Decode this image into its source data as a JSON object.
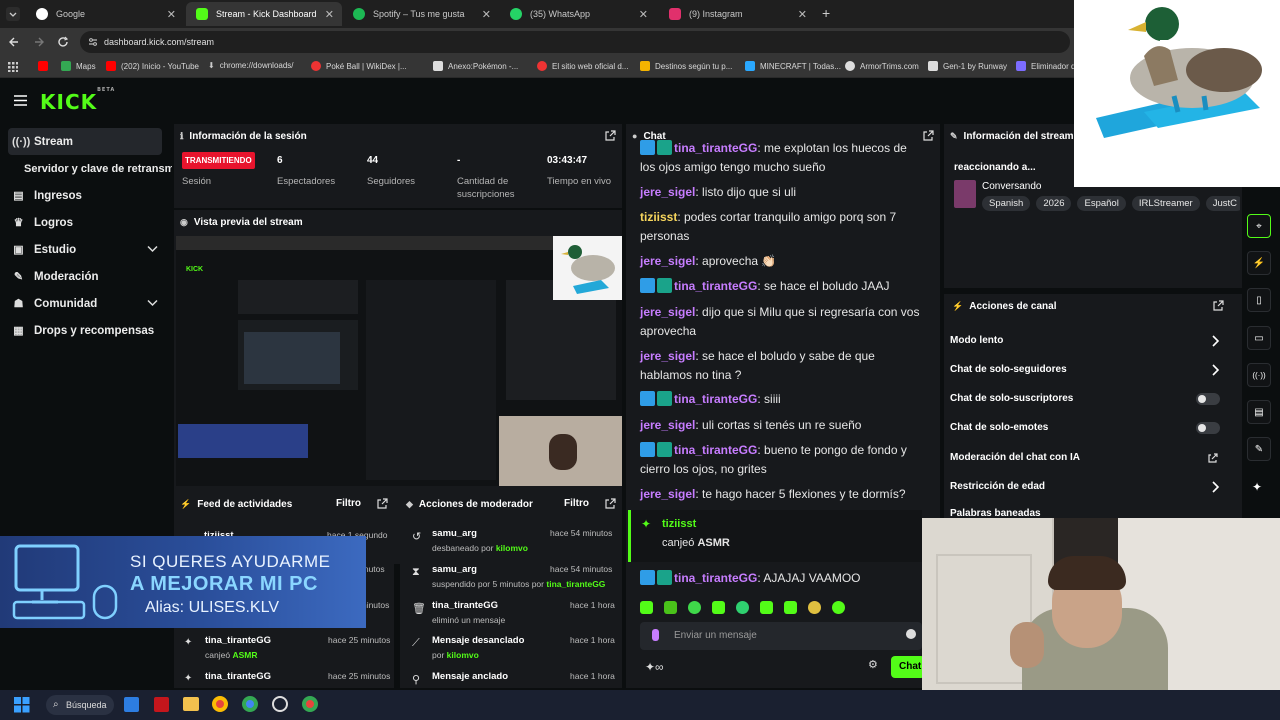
{
  "browser": {
    "tabs": [
      {
        "title": "Google",
        "active": false,
        "color": "#ffffff"
      },
      {
        "title": "Stream - Kick Dashboard",
        "active": true,
        "color": "#53fc18"
      },
      {
        "title": "Spotify – Tus me gusta",
        "active": false,
        "color": "#1db954"
      },
      {
        "title": "(35) WhatsApp",
        "active": false,
        "color": "#25d366"
      },
      {
        "title": "(9) Instagram",
        "active": false,
        "color": "#e1306c"
      }
    ],
    "new_tab": "+",
    "url": "dashboard.kick.com/stream",
    "bookmarks": [
      {
        "label": "",
        "color": "#ff0000"
      },
      {
        "label": "Maps",
        "color": "#34a853"
      },
      {
        "label": "(202) Inicio - YouTube",
        "color": "#ff0000"
      },
      {
        "label": "chrome://downloads/",
        "color": "#aaaaaa"
      },
      {
        "label": "Poké Ball | WikiDex |...",
        "color": "#e33"
      },
      {
        "label": "Anexo:Pokémon -...",
        "color": "#ddd"
      },
      {
        "label": "El sitio web oficial d...",
        "color": "#e33"
      },
      {
        "label": "Destinos según tu p...",
        "color": "#f4b400"
      },
      {
        "label": "MINECRAFT | Todas...",
        "color": "#2aa8ff"
      },
      {
        "label": "ArmorTrims.com",
        "color": "#ddd"
      },
      {
        "label": "Gen-1 by Runway",
        "color": "#ddd"
      },
      {
        "label": "Eliminador d",
        "color": "#7c6cff"
      }
    ]
  },
  "kick": {
    "logo": "KICK",
    "logo_sup": "BETA",
    "sidebar": [
      {
        "label": "Stream",
        "active": true,
        "icon": "stream-icon"
      },
      {
        "label": "Servidor y clave de retransmisión",
        "active": false,
        "icon": ""
      },
      {
        "label": "Ingresos",
        "active": false,
        "icon": "bank-icon"
      },
      {
        "label": "Logros",
        "active": false,
        "icon": "trophy-icon"
      },
      {
        "label": "Estudio",
        "active": false,
        "icon": "monitor-icon",
        "expandable": true
      },
      {
        "label": "Moderación",
        "active": false,
        "icon": "wrench-icon"
      },
      {
        "label": "Comunidad",
        "active": false,
        "icon": "people-icon",
        "expandable": true
      },
      {
        "label": "Drops y recompensas",
        "active": false,
        "icon": "gift-icon"
      }
    ],
    "session": {
      "title": "Información de la sesión",
      "status": "TRANSMITIENDO",
      "status_label": "Sesión",
      "stats": [
        {
          "value": "6",
          "label": "Espectadores"
        },
        {
          "value": "44",
          "label": "Seguidores"
        },
        {
          "value": "-",
          "label": "Cantidad de suscripciones"
        },
        {
          "value": "03:43:47",
          "label": "Tiempo en vivo"
        }
      ]
    },
    "preview": {
      "title": "Vista previa del stream"
    },
    "overlay": {
      "line1": "SI QUERES AYUDARME",
      "line2": "A MEJORAR MI PC",
      "line3": "Alias: ULISES.KLV"
    },
    "feed": {
      "title": "Feed de actividades",
      "filter": "Filtro",
      "items": [
        {
          "name": "tiziisst",
          "sub": "",
          "time": "hace 1 segundo"
        },
        {
          "name": "",
          "sub": "",
          "time": "hace 5 minutos"
        },
        {
          "name": "",
          "sub": "",
          "time": "hace 25 minutos"
        },
        {
          "name": "tina_tiranteGG",
          "sub": "canjeó",
          "reward": "ASMR",
          "time": "hace 25 minutos"
        },
        {
          "name": "tina_tiranteGG",
          "sub": "",
          "time": "hace 25 minutos"
        }
      ]
    },
    "modactions": {
      "title": "Acciones de moderador",
      "filter": "Filtro",
      "items": [
        {
          "name": "samu_arg",
          "sub": "desbaneado por",
          "by": "kilomvo",
          "time": "hace 54 minutos",
          "icon": "undo-icon"
        },
        {
          "name": "samu_arg",
          "sub": "suspendido por 5 minutos por",
          "by": "tina_tiranteGG",
          "time": "hace 54 minutos",
          "icon": "hourglass-icon"
        },
        {
          "name": "tina_tiranteGG",
          "sub": "eliminó un mensaje",
          "by": "",
          "time": "hace 1 hora",
          "icon": "trash-icon"
        },
        {
          "name": "Mensaje desanclado",
          "sub": "por",
          "by": "kilomvo",
          "time": "hace 1 hora",
          "icon": "unpin-icon"
        },
        {
          "name": "Mensaje anclado",
          "sub": "",
          "by": "",
          "time": "hace 1 hora",
          "icon": "pin-icon"
        }
      ]
    },
    "chat": {
      "title": "Chat",
      "messages": [
        {
          "user": "tina_tiranteGG",
          "color": "violet",
          "badges": 2,
          "text": ": me explotan los huecos de los ojos amigo tengo mucho sueño"
        },
        {
          "user": "jere_sigel",
          "color": "violet",
          "badges": 0,
          "text": ": listo dijo que si uli"
        },
        {
          "user": "tiziisst",
          "color": "yellow",
          "badges": 0,
          "text": ": podes cortar tranquilo amigo porq son 7 personas"
        },
        {
          "user": "jere_sigel",
          "color": "violet",
          "badges": 0,
          "text": ": aprovecha 👏🏻"
        },
        {
          "user": "tina_tiranteGG",
          "color": "violet",
          "badges": 2,
          "text": ": se hace el boludo JAAJ"
        },
        {
          "user": "jere_sigel",
          "color": "violet",
          "badges": 0,
          "text": ": dijo que si Milu que si regresaría con vos aprovecha"
        },
        {
          "user": "jere_sigel",
          "color": "violet",
          "badges": 0,
          "text": ": se hace el boludo y sabe de que hablamos no tina ?"
        },
        {
          "user": "tina_tiranteGG",
          "color": "violet",
          "badges": 2,
          "text": ": siiii"
        },
        {
          "user": "jere_sigel",
          "color": "violet",
          "badges": 0,
          "text": ": uli cortas si tenés un re sueño"
        },
        {
          "user": "tina_tiranteGG",
          "color": "violet",
          "badges": 2,
          "text": ": bueno te pongo de fondo y cierro los ojos, no grites"
        },
        {
          "user": "jere_sigel",
          "color": "violet",
          "badges": 0,
          "text": ": te hago hacer 5 flexiones y te dormís?"
        },
        {
          "user": "tina_tiranteGG",
          "color": "violet",
          "badges": 2,
          "text": ": AJAJAJ VAAMOO"
        }
      ],
      "redeem": {
        "user": "tiziisst",
        "text": "canjeó",
        "reward": "ASMR"
      },
      "placeholder": "Enviar un mensaje",
      "send": "Chat"
    },
    "streaminfo": {
      "title": "Información del stream",
      "stream_title": "reaccionando a...",
      "category": "Conversando",
      "tags": [
        "Spanish",
        "2026",
        "Español",
        "IRLStreamer",
        "JustC"
      ]
    },
    "channel": {
      "title": "Acciones de canal",
      "items": [
        {
          "label": "Modo lento",
          "control": "chevron"
        },
        {
          "label": "Chat de solo-seguidores",
          "control": "chevron"
        },
        {
          "label": "Chat de solo-suscriptores",
          "control": "toggle"
        },
        {
          "label": "Chat de solo-emotes",
          "control": "toggle"
        },
        {
          "label": "Moderación del chat con IA",
          "control": "link"
        },
        {
          "label": "Restricción de edad",
          "control": "chevron"
        },
        {
          "label": "Palabras baneadas",
          "control": "chevron"
        }
      ]
    }
  },
  "taskbar": {
    "search": "Búsqueda"
  },
  "colors": {
    "accent": "#53fc18",
    "live": "#e8142d",
    "panel": "#17191c",
    "bg": "#0b0e0f"
  }
}
